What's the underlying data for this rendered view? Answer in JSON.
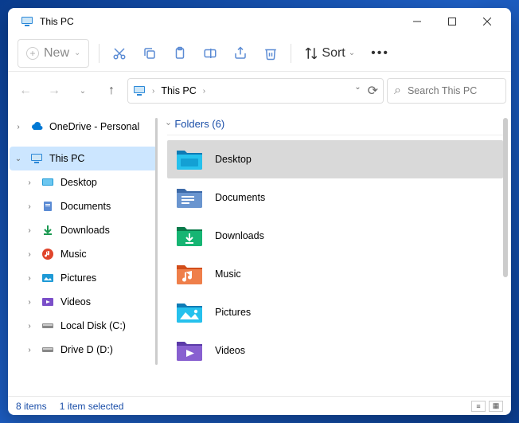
{
  "window": {
    "title": "This PC"
  },
  "toolbar": {
    "new": "New",
    "sort": "Sort"
  },
  "breadcrumb": {
    "loc": "This PC"
  },
  "search": {
    "placeholder": "Search This PC"
  },
  "nav": {
    "items": [
      {
        "label": "OneDrive - Personal",
        "expanded": false
      },
      {
        "label": "This PC",
        "expanded": true,
        "selected": true
      },
      {
        "label": "Desktop"
      },
      {
        "label": "Documents"
      },
      {
        "label": "Downloads"
      },
      {
        "label": "Music"
      },
      {
        "label": "Pictures"
      },
      {
        "label": "Videos"
      },
      {
        "label": "Local Disk (C:)"
      },
      {
        "label": "Drive D (D:)"
      }
    ]
  },
  "section": {
    "title": "Folders (6)"
  },
  "folders": [
    {
      "label": "Desktop",
      "selected": true
    },
    {
      "label": "Documents"
    },
    {
      "label": "Downloads"
    },
    {
      "label": "Music"
    },
    {
      "label": "Pictures"
    },
    {
      "label": "Videos"
    }
  ],
  "status": {
    "count": "8 items",
    "selection": "1 item selected"
  }
}
